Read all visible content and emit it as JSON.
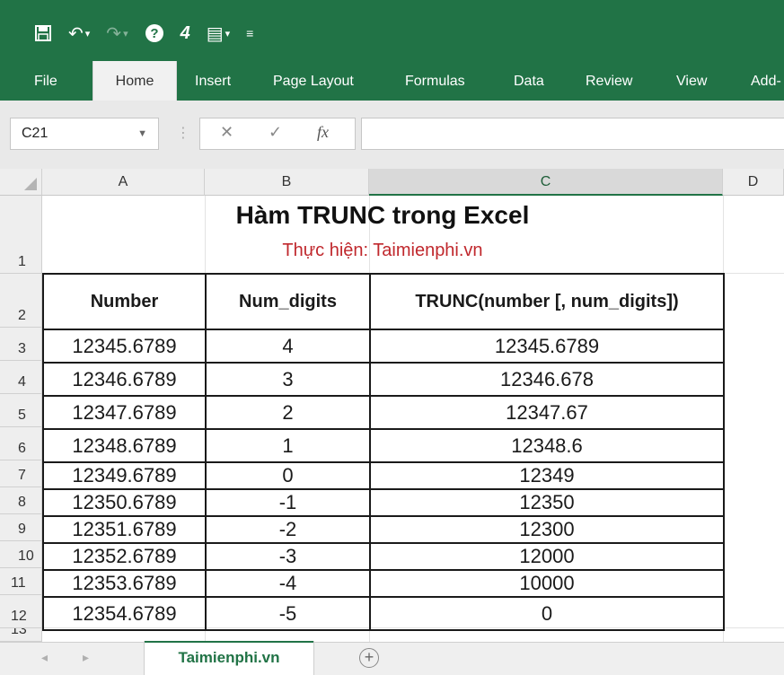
{
  "ribbon": {
    "tabs": [
      "File",
      "Home",
      "Insert",
      "Page Layout",
      "Formulas",
      "Data",
      "Review",
      "View",
      "Add-"
    ],
    "active_tab": "Home"
  },
  "formula_bar": {
    "name_box": "C21",
    "cancel_glyph": "✕",
    "enter_glyph": "✓",
    "fx_label": "fx",
    "formula": ""
  },
  "columns": [
    "A",
    "B",
    "C",
    "D"
  ],
  "selected_column": "C",
  "rows": [
    "1",
    "2",
    "3",
    "4",
    "5",
    "6",
    "7",
    "8",
    "9",
    "10",
    "11",
    "12",
    "13"
  ],
  "sheet": {
    "title": "Hàm TRUNC trong Excel",
    "subtitle": "Thực hiện: Taimienphi.vn",
    "headers": [
      "Number",
      "Num_digits",
      "TRUNC(number [, num_digits])"
    ],
    "data": [
      [
        "12345.6789",
        "4",
        "12345.6789"
      ],
      [
        "12346.6789",
        "3",
        "12346.678"
      ],
      [
        "12347.6789",
        "2",
        "12347.67"
      ],
      [
        "12348.6789",
        "1",
        "12348.6"
      ],
      [
        "12349.6789",
        "0",
        "12349"
      ],
      [
        "12350.6789",
        "-1",
        "12350"
      ],
      [
        "12351.6789",
        "-2",
        "12300"
      ],
      [
        "12352.6789",
        "-3",
        "12000"
      ],
      [
        "12353.6789",
        "-4",
        "10000"
      ],
      [
        "12354.6789",
        "-5",
        "0"
      ]
    ]
  },
  "sheet_tabs": {
    "active": "Taimienphi.vn",
    "add_glyph": "+"
  },
  "colors": {
    "accent": "#217346",
    "subtitle": "#c0282d"
  }
}
